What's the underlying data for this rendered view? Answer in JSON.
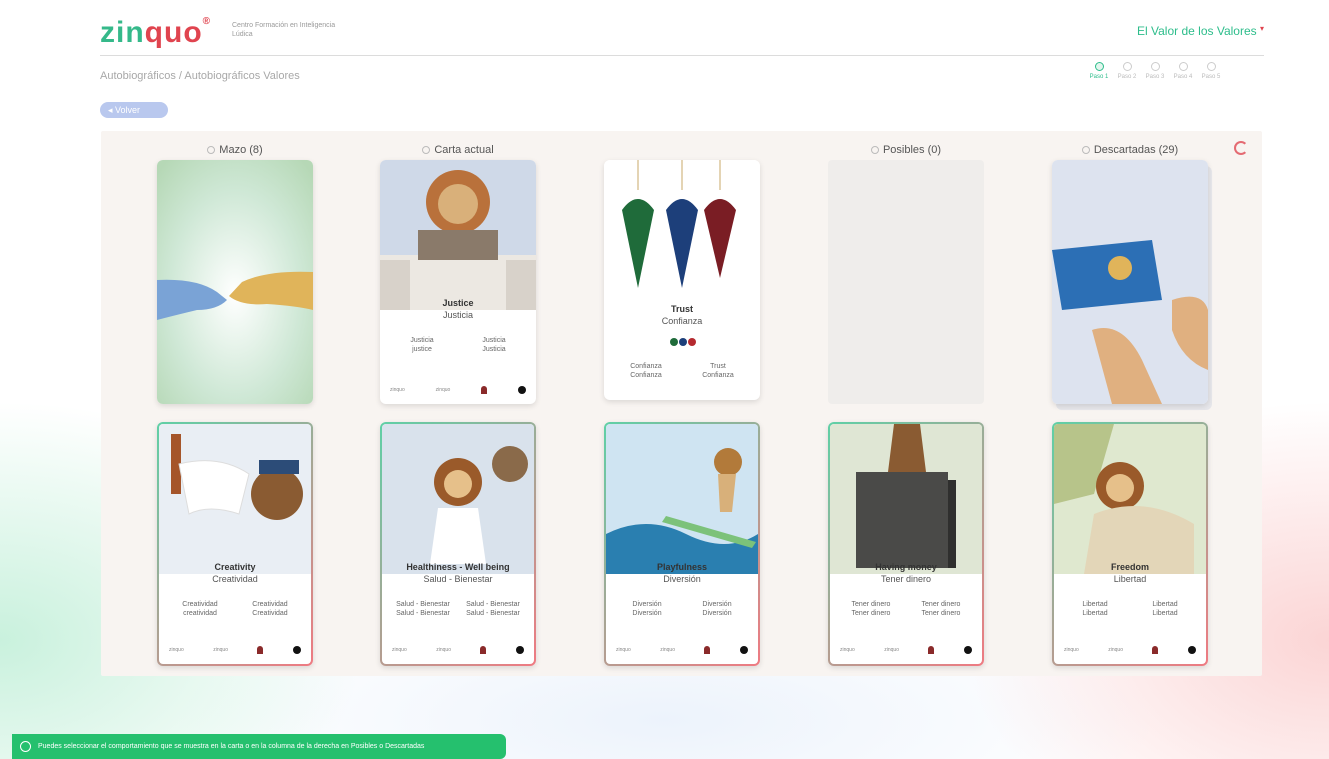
{
  "app": {
    "logo": "zinquo",
    "tagline": "Centro Formación en Inteligencia Lúdica",
    "page_title": "El Valor de los Valores",
    "breadcrumb": "Autobiográficos / Autobiográficos Valores",
    "back_label": "Volver",
    "colors": {
      "accent_green": "#2dbd8b",
      "accent_red": "#e0444f",
      "pill_blue": "#b9c8ee"
    }
  },
  "steps": [
    {
      "label": "Paso 1",
      "active": true
    },
    {
      "label": "Paso 2",
      "active": false
    },
    {
      "label": "Paso 3",
      "active": false
    },
    {
      "label": "Paso 4",
      "active": false
    },
    {
      "label": "Paso 5",
      "active": false
    }
  ],
  "columns": [
    {
      "title": "Mazo (8)"
    },
    {
      "title": "Carta actual"
    },
    {
      "title": ""
    },
    {
      "title": "Posibles (0)"
    },
    {
      "title": "Descartadas (29)"
    }
  ],
  "top_cards": {
    "current": {
      "title": "Justice",
      "subtitle": "Justicia",
      "left": "Justicia\njustice",
      "right": "Justicia\nJusticia"
    },
    "pendulum": {
      "title": "Trust",
      "subtitle": "Confianza",
      "left": "Confianza\nConfianza",
      "right": "Trust\nConfianza"
    }
  },
  "cards": [
    {
      "title": "Creativity",
      "subtitle": "Creatividad",
      "left": "Creatividad\ncreatividad",
      "right": "Creatividad\nCreatividad"
    },
    {
      "title": "Healthiness - Well being",
      "subtitle": "Salud - Bienestar",
      "left": "Salud - Bienestar\nSalud - Bienestar",
      "right": "Salud - Bienestar\nSalud - Bienestar"
    },
    {
      "title": "Playfulness",
      "subtitle": "Diversión",
      "left": "Diversión\nDiversión",
      "right": "Diversión\nDiversión"
    },
    {
      "title": "Having money",
      "subtitle": "Tener dinero",
      "left": "Tener dinero\nTener dinero",
      "right": "Tener dinero\nTener dinero"
    },
    {
      "title": "Freedom",
      "subtitle": "Libertad",
      "left": "Libertad\nLibertad",
      "right": "Libertad\nLibertad"
    }
  ],
  "toast": "Puedes seleccionar el comportamiento que se muestra en la carta o en la columna de la derecha en Posibles o Descartadas"
}
